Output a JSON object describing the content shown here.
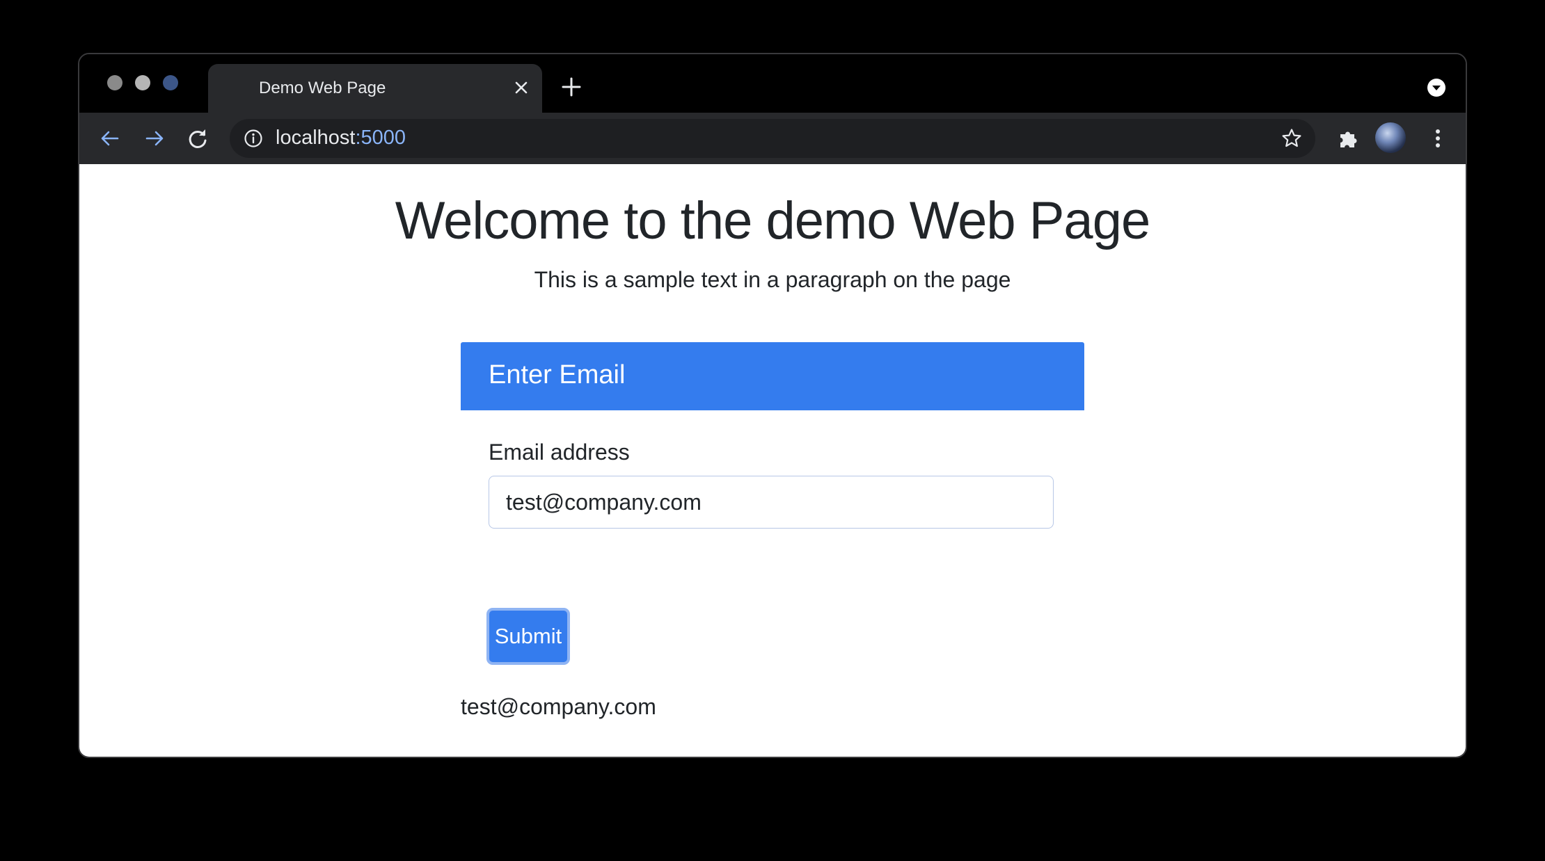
{
  "browser": {
    "tab": {
      "title": "Demo Web Page"
    },
    "address_bar": {
      "host": "localhost",
      "port": ":5000"
    },
    "icons": {
      "close": "close-icon",
      "new_tab": "plus-icon",
      "tab_search": "chevron-down-circle-icon",
      "back": "arrow-left-icon",
      "forward": "arrow-right-icon",
      "reload": "reload-icon",
      "site_info": "info-icon",
      "bookmark": "star-icon",
      "extensions": "puzzle-icon",
      "menu": "kebab-menu-icon"
    },
    "colors": {
      "frame": "#000000",
      "toolbar": "#28292c",
      "link_accent": "#8ab4f8"
    }
  },
  "page": {
    "heading": "Welcome to the demo Web Page",
    "paragraph": "This is a sample text in a paragraph on the page",
    "card": {
      "header": "Enter Email",
      "email_label": "Email address",
      "email_value": "test@company.com",
      "submit_label": "Submit"
    },
    "result_text": "test@company.com",
    "colors": {
      "primary": "#347cee",
      "text": "#212529"
    }
  }
}
